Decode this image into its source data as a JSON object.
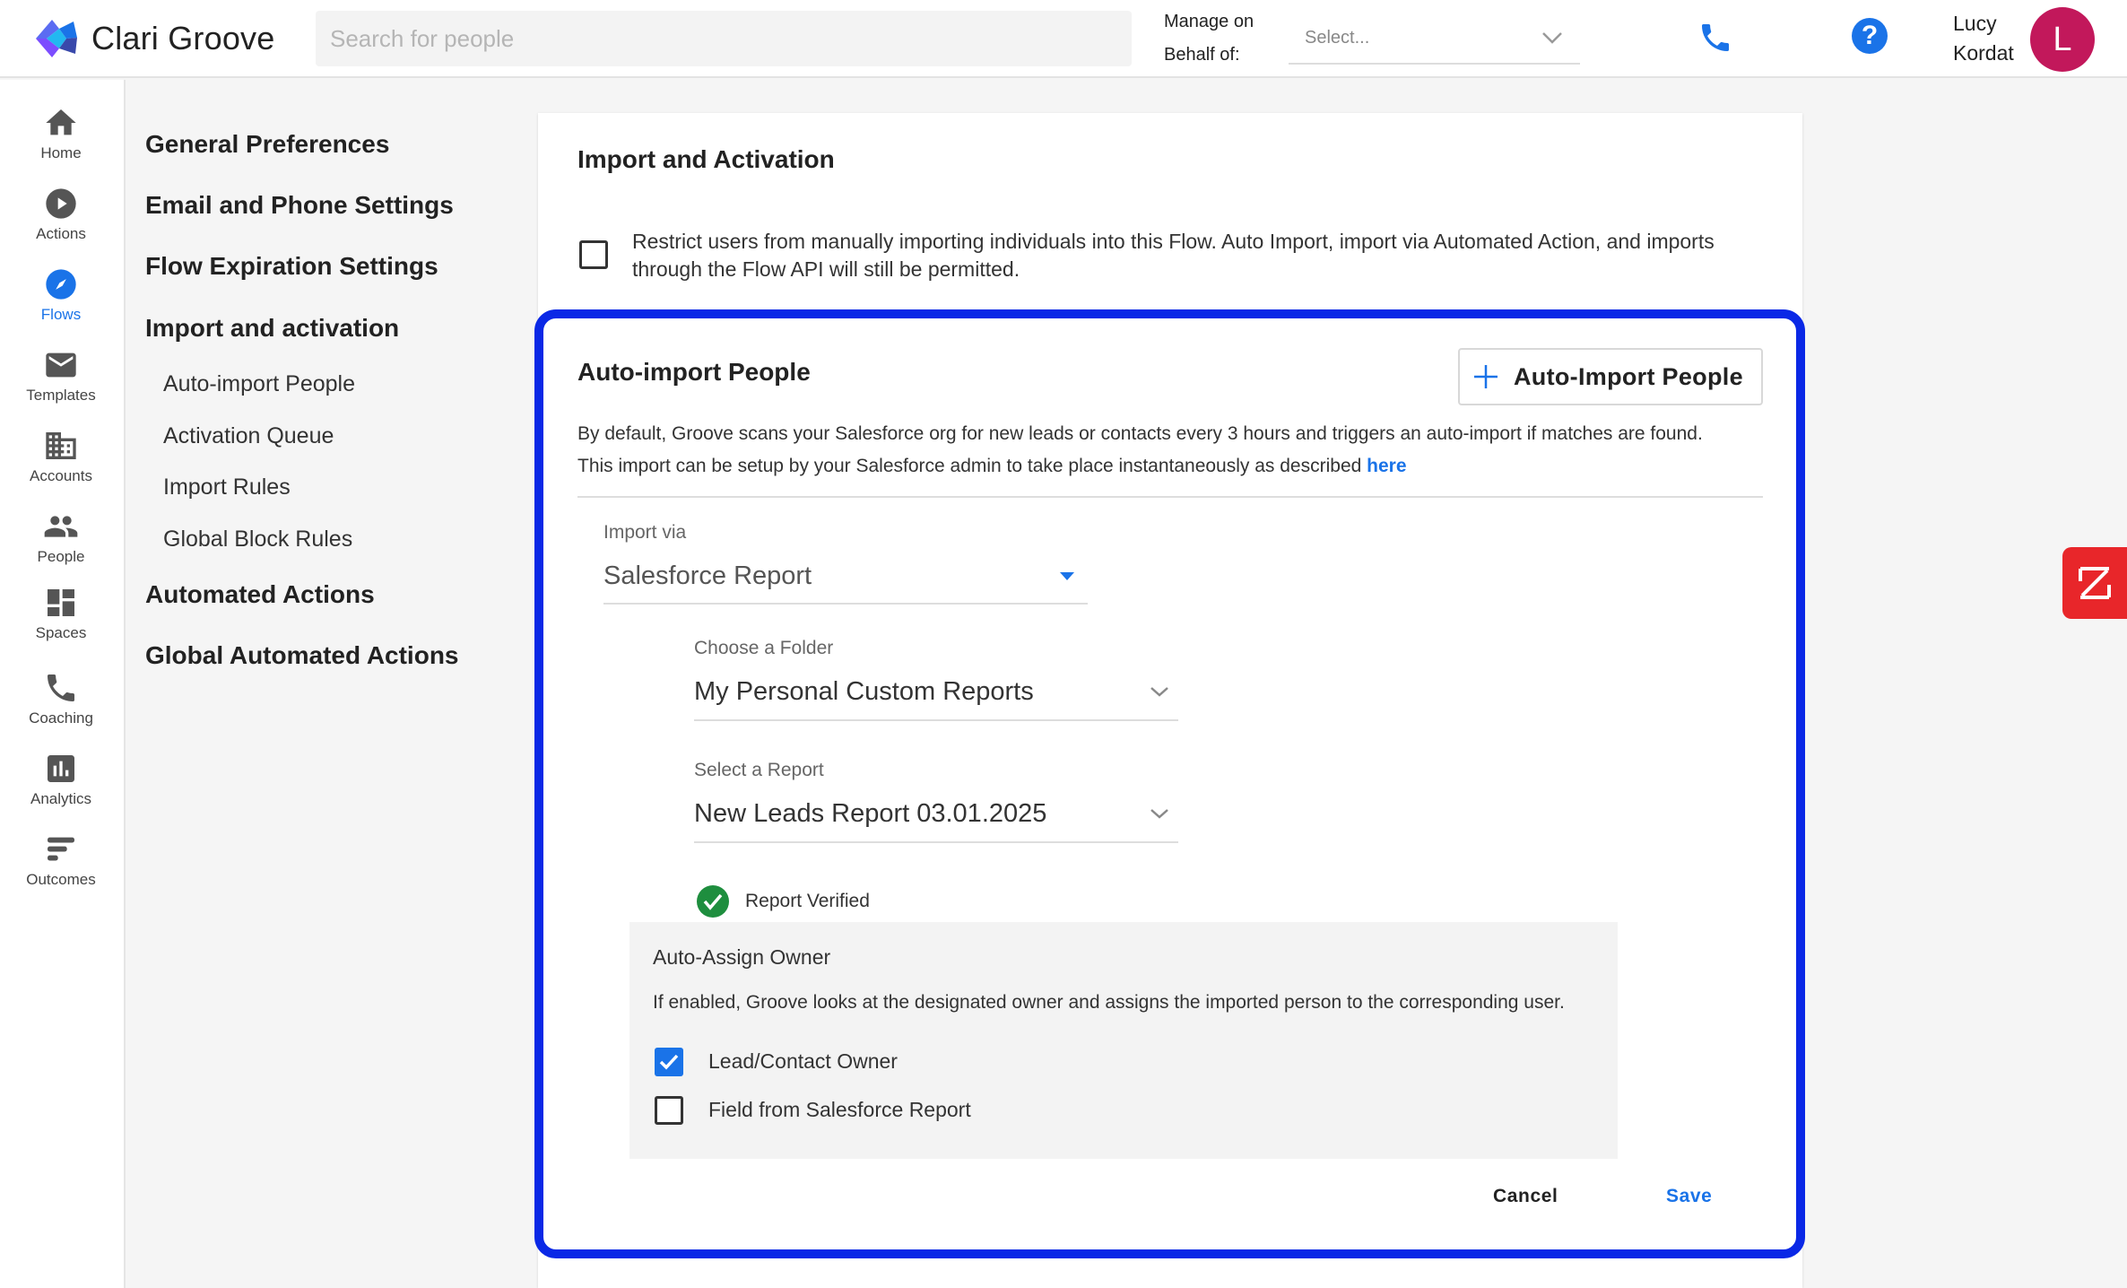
{
  "app": {
    "name": "Clari Groove"
  },
  "header": {
    "search_placeholder": "Search for people",
    "behalf_label": "Manage on Behalf of:",
    "behalf_value": "Select...",
    "user_name": "Lucy Kordat",
    "avatar_initial": "L"
  },
  "leftnav": {
    "items": [
      {
        "label": "Home"
      },
      {
        "label": "Actions"
      },
      {
        "label": "Flows"
      },
      {
        "label": "Templates"
      },
      {
        "label": "Accounts"
      },
      {
        "label": "People"
      },
      {
        "label": "Spaces"
      },
      {
        "label": "Coaching"
      },
      {
        "label": "Analytics"
      },
      {
        "label": "Outcomes"
      }
    ],
    "active": "Flows"
  },
  "settings_nav": {
    "general": "General Preferences",
    "email_phone": "Email and Phone Settings",
    "flow_expiration": "Flow Expiration Settings",
    "import_activation": "Import and activation",
    "auto_import": "Auto-import People",
    "activation_queue": "Activation Queue",
    "import_rules": "Import Rules",
    "global_block": "Global Block Rules",
    "automated_actions": "Automated Actions",
    "global_automated_actions": "Global Automated Actions"
  },
  "main": {
    "title": "Import and Activation",
    "restrict_text": "Restrict users from manually importing individuals into this Flow. Auto Import, import via Automated Action, and imports through the Flow API will still be permitted.",
    "auto_import": {
      "title": "Auto-import People",
      "button_label": "Auto-Import People",
      "desc_line1": "By default, Groove scans your Salesforce org for new leads or contacts every 3 hours and triggers an auto-import if matches are found.",
      "desc_line2": "This import can be setup by your Salesforce admin to take place instantaneously as described",
      "desc_link": "here",
      "import_via_label": "Import via",
      "import_via_value": "Salesforce Report",
      "folder_label": "Choose a Folder",
      "folder_value": "My Personal Custom Reports",
      "report_label": "Select a Report",
      "report_value": "New Leads Report 03.01.2025",
      "verified_text": "Report Verified",
      "assign": {
        "title": "Auto-Assign Owner",
        "desc": "If enabled, Groove looks at the designated owner and assigns the imported person to the corresponding user.",
        "options": [
          {
            "label": "Lead/Contact Owner",
            "checked": true
          },
          {
            "label": "Field from Salesforce Report",
            "checked": false
          }
        ]
      },
      "cancel_label": "Cancel",
      "save_label": "Save"
    }
  },
  "colors": {
    "accent": "#1a73e8",
    "highlight": "#0a28e6",
    "avatar": "#c2185b",
    "verified": "#1e8e3e",
    "badge": "#e8262a"
  }
}
